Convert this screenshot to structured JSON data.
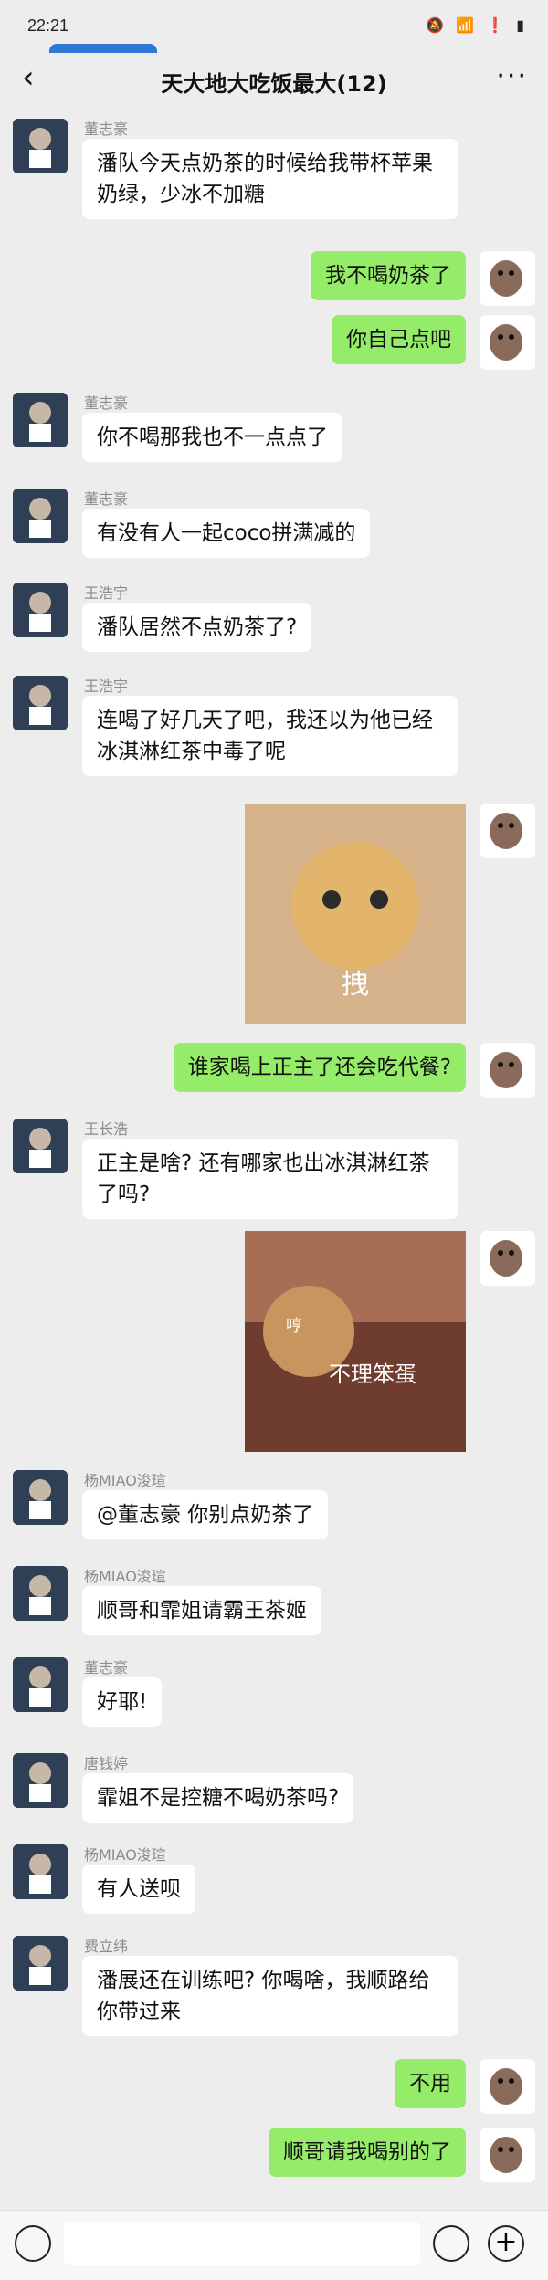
{
  "status_bar": {
    "time": "22:21"
  },
  "header": {
    "title": "天大地大吃饭最大(12)",
    "back_label": "‹",
    "more_label": "···"
  },
  "messages": [
    {
      "side": "left",
      "name": "董志豪",
      "text": "潘队今天点奶茶的时候给我带杯苹果奶绿，少冰不加糖"
    },
    {
      "side": "right",
      "text": "我不喝奶茶了"
    },
    {
      "side": "right",
      "text": "你自己点吧"
    },
    {
      "side": "left",
      "name": "董志豪",
      "text": "你不喝那我也不一点点了"
    },
    {
      "side": "left",
      "name": "董志豪",
      "text": "有没有人一起coco拼满减的"
    },
    {
      "side": "left",
      "name": "王浩宇",
      "text": "潘队居然不点奶茶了?"
    },
    {
      "side": "left",
      "name": "王浩宇",
      "text": "连喝了好几天了吧，我还以为他已经冰淇淋红茶中毒了呢"
    },
    {
      "side": "right",
      "type": "image",
      "caption": "拽"
    },
    {
      "side": "right",
      "text": "谁家喝上正主了还会吃代餐?"
    },
    {
      "side": "left",
      "name": "王长浩",
      "text": "正主是啥? 还有哪家也出冰淇淋红茶了吗?"
    },
    {
      "side": "right",
      "type": "image",
      "caption": "不理笨蛋",
      "small_caption": "哼"
    },
    {
      "side": "left",
      "name": "杨MIAO浚瑄",
      "text": "@董志豪 你别点奶茶了"
    },
    {
      "side": "left",
      "name": "杨MIAO浚瑄",
      "text": "顺哥和霏姐请霸王茶姬"
    },
    {
      "side": "left",
      "name": "董志豪",
      "text": "好耶!"
    },
    {
      "side": "left",
      "name": "唐钱婷",
      "text": "霏姐不是控糖不喝奶茶吗?"
    },
    {
      "side": "left",
      "name": "杨MIAO浚瑄",
      "text": "有人送呗"
    },
    {
      "side": "left",
      "name": "费立纬",
      "text": "潘展还在训练吧? 你喝啥，我顺路给你带过来"
    },
    {
      "side": "right",
      "text": "不用"
    },
    {
      "side": "right",
      "text": "顺哥请我喝别的了"
    }
  ],
  "colors": {
    "bg": "#ededed",
    "bubble_left": "#ffffff",
    "bubble_right": "#95ec69",
    "name": "#8c8c8c"
  }
}
